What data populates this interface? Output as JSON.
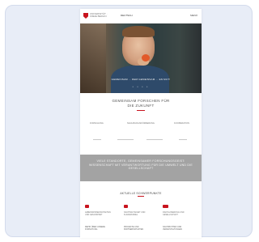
{
  "header": {
    "logo_text": "UNIVERSITÄT · FREIE BERLIN",
    "nav_label": "DEUTSCH",
    "menu_label": "MENÜ"
  },
  "hero": {
    "caption": "GEMEINSAM ... DEM GEMEINSAM ... EN MUT!",
    "dots": "• • • •"
  },
  "intro": {
    "title_line1": "GEMEINSAM FORSCHEN FÜR",
    "title_line2": "DIE ZUKUNFT"
  },
  "chips": [
    "FORSCHUNG",
    "NACHWUCHSFÖRDERUNG",
    "KOOPERATION",
    "TRANSFER",
    "STRATEGIE",
    "LEHRE"
  ],
  "band": {
    "text": "VIELE STANDORTE, GEMEINSAMER FORSCHUNGSGEIST: WISSENSCHAFT MIT VERANTWORTUNG FÜR DIE UMWELT UND DIE GESELLSCHAFT"
  },
  "section2": {
    "title": "AKTUELLE SCHWERPUNKTE"
  },
  "features": [
    {
      "icon": "flask-icon",
      "text": "LEBENSWISSENSCHAFTEN UND GESUNDHEIT"
    },
    {
      "icon": "globe-icon",
      "text": "NACHHALTIGKEIT UND KLIMAWANDEL"
    },
    {
      "icon": "network-icon",
      "text": "DIGITALISIERUNG UND GESELLSCHAFT"
    }
  ],
  "links": [
    {
      "text": "MEHR ÜBER UNSERE FORSCHUNG"
    },
    {
      "text": "PROJEKTE UND PARTNERSCHAFTEN"
    },
    {
      "text": "NACHRICHTEN UND VERANSTALTUNGEN"
    }
  ],
  "colors": {
    "accent": "#c8141e",
    "frame_bg": "#e8edf7",
    "band_bg": "#a3a3a3"
  }
}
